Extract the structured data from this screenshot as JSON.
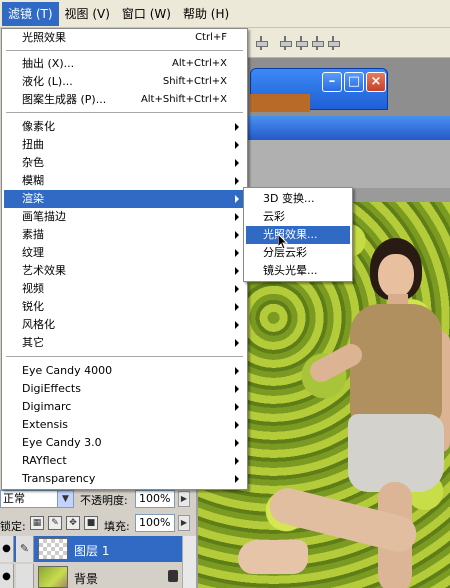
{
  "menubar": {
    "items": [
      {
        "label": "滤镜 (T)",
        "active": true
      },
      {
        "label": "视图 (V)"
      },
      {
        "label": "窗口 (W)"
      },
      {
        "label": "帮助 (H)"
      }
    ]
  },
  "filter_menu": {
    "last_filter": {
      "label": "光照效果",
      "shortcut": "Ctrl+F"
    },
    "tools": [
      {
        "label": "抽出 (X)...",
        "shortcut": "Alt+Ctrl+X"
      },
      {
        "label": "液化 (L)...",
        "shortcut": "Shift+Ctrl+X"
      },
      {
        "label": "图案生成器 (P)...",
        "shortcut": "Alt+Shift+Ctrl+X"
      }
    ],
    "categories": [
      "像素化",
      "扭曲",
      "杂色",
      "模糊",
      "渲染",
      "画笔描边",
      "素描",
      "纹理",
      "艺术效果",
      "视频",
      "锐化",
      "风格化",
      "其它"
    ],
    "highlighted_category": "渲染",
    "plugins": [
      "Eye Candy 4000",
      "DigiEffects",
      "Digimarc",
      "Extensis",
      "Eye Candy 3.0",
      "RAYflect",
      "Transparency"
    ]
  },
  "render_submenu": {
    "items": [
      "3D 变换...",
      "云彩",
      "光照效果...",
      "分层云彩",
      "镜头光晕..."
    ],
    "highlighted": "光照效果..."
  },
  "layers_panel": {
    "blend_mode": "正常",
    "opacity_label": "不透明度:",
    "opacity_value": "100%",
    "lock_label": "锁定:",
    "fill_label": "填充:",
    "fill_value": "100%",
    "layers": [
      {
        "name": "图层 1",
        "selected": true
      },
      {
        "name": "背景",
        "locked": true
      }
    ]
  },
  "colors": {
    "highlight": "#316ac5",
    "menu_bg": "#ffffff",
    "chrome": "#ece9d8"
  }
}
